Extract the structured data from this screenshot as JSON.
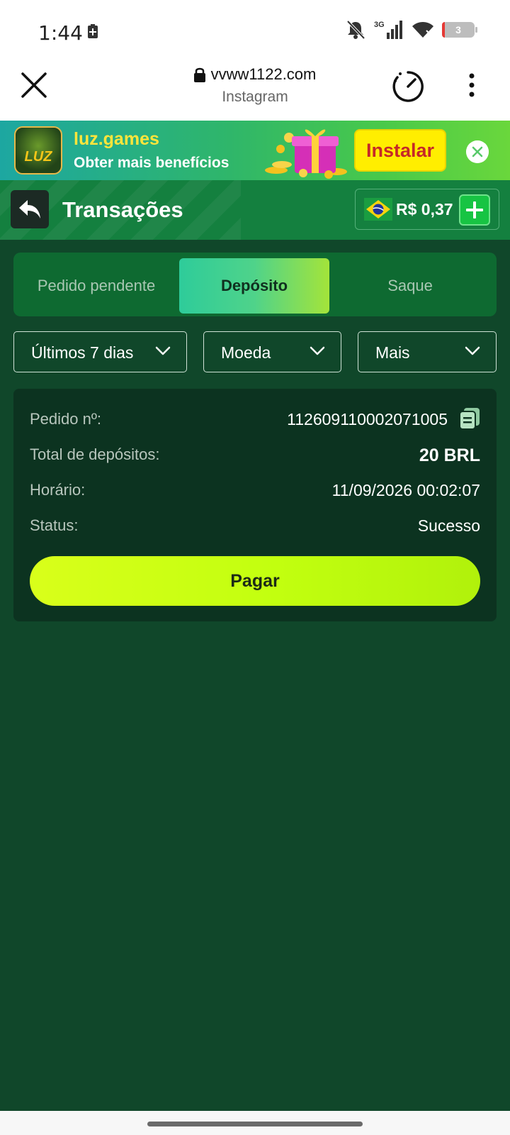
{
  "status_bar": {
    "time": "1:44",
    "network": "3G",
    "battery_level": "3",
    "icons": [
      "battery-saver-icon",
      "bell-muted-icon",
      "signal-icon",
      "wifi-icon",
      "battery-icon"
    ]
  },
  "browser": {
    "domain": "vvww1122.com",
    "source_app": "Instagram"
  },
  "banner": {
    "title": "luz.games",
    "subtitle": "Obter mais benefícios",
    "logo_text": "LUZ",
    "install_label": "Instalar"
  },
  "header": {
    "title": "Transações",
    "balance": "R$ 0,37"
  },
  "tabs": [
    {
      "label": "Pedido pendente",
      "active": false
    },
    {
      "label": "Depósito",
      "active": true
    },
    {
      "label": "Saque",
      "active": false
    }
  ],
  "filters": {
    "period": "Últimos 7 dias",
    "currency": "Moeda",
    "more": "Mais"
  },
  "transaction": {
    "order_label": "Pedido nº:",
    "order_number": "112609110002071005",
    "total_label": "Total de depósitos:",
    "total_value": "20 BRL",
    "time_label": "Horário:",
    "time_value": "11/09/2026 00:02:07",
    "status_label": "Status:",
    "status_value": "Sucesso",
    "pay_label": "Pagar"
  },
  "colors": {
    "page_bg": "#10472a",
    "header_bg": "#14803f",
    "card_bg": "#0c3320",
    "pay_button": "#c2ff0f",
    "install_button": "#ffee00"
  }
}
